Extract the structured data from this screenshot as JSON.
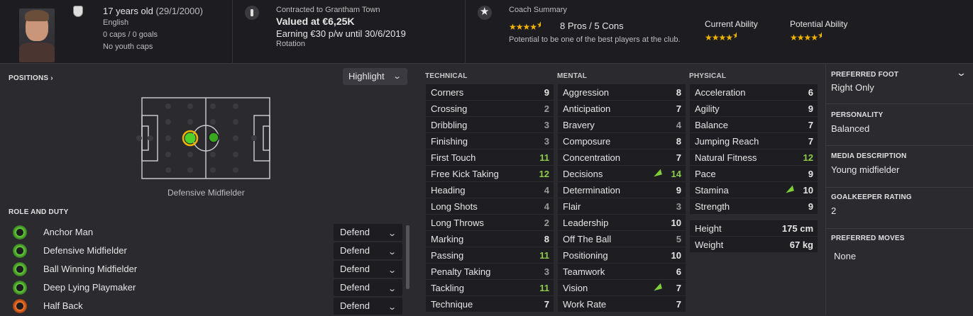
{
  "player": {
    "age_text": "17 years old",
    "dob": "(29/1/2000)",
    "nationality": "English",
    "caps": "0 caps / 0 goals",
    "youth_caps": "No youth caps"
  },
  "contract": {
    "club_line": "Contracted to Grantham Town",
    "value": "Valued at €6,25K",
    "wage": "Earning €30 p/w until 30/6/2019",
    "status": "Rotation"
  },
  "coach": {
    "title": "Coach Summary",
    "pros_cons": "8 Pros / 5 Cons",
    "summary": "Potential to be one of the best players at the club.",
    "rating_stars": 4.5,
    "current_ability_label": "Current Ability",
    "current_ability_stars": 4.5,
    "potential_ability_label": "Potential Ability",
    "potential_ability_stars": 4.5
  },
  "positions": {
    "title": "POSITIONS",
    "highlight_label": "Highlight",
    "position_name": "Defensive Midfielder"
  },
  "role": {
    "title": "ROLE AND DUTY",
    "rows": [
      {
        "name": "Anchor Man",
        "duty": "Defend"
      },
      {
        "name": "Defensive Midfielder",
        "duty": "Defend"
      },
      {
        "name": "Ball Winning Midfielder",
        "duty": "Defend"
      },
      {
        "name": "Deep Lying Playmaker",
        "duty": "Defend"
      },
      {
        "name": "Half Back",
        "duty": "Defend"
      }
    ]
  },
  "technical": {
    "title": "TECHNICAL",
    "rows": [
      {
        "name": "Corners",
        "value": "9"
      },
      {
        "name": "Crossing",
        "value": "2"
      },
      {
        "name": "Dribbling",
        "value": "3"
      },
      {
        "name": "Finishing",
        "value": "3"
      },
      {
        "name": "First Touch",
        "value": "11"
      },
      {
        "name": "Free Kick Taking",
        "value": "12"
      },
      {
        "name": "Heading",
        "value": "4"
      },
      {
        "name": "Long Shots",
        "value": "4"
      },
      {
        "name": "Long Throws",
        "value": "2"
      },
      {
        "name": "Marking",
        "value": "8"
      },
      {
        "name": "Passing",
        "value": "11"
      },
      {
        "name": "Penalty Taking",
        "value": "3"
      },
      {
        "name": "Tackling",
        "value": "11"
      },
      {
        "name": "Technique",
        "value": "7"
      }
    ]
  },
  "mental": {
    "title": "MENTAL",
    "rows": [
      {
        "name": "Aggression",
        "value": "8"
      },
      {
        "name": "Anticipation",
        "value": "7"
      },
      {
        "name": "Bravery",
        "value": "4"
      },
      {
        "name": "Composure",
        "value": "8"
      },
      {
        "name": "Concentration",
        "value": "7"
      },
      {
        "name": "Decisions",
        "value": "14"
      },
      {
        "name": "Determination",
        "value": "9"
      },
      {
        "name": "Flair",
        "value": "3"
      },
      {
        "name": "Leadership",
        "value": "10"
      },
      {
        "name": "Off The Ball",
        "value": "5"
      },
      {
        "name": "Positioning",
        "value": "10"
      },
      {
        "name": "Teamwork",
        "value": "6"
      },
      {
        "name": "Vision",
        "value": "7"
      },
      {
        "name": "Work Rate",
        "value": "7"
      }
    ]
  },
  "physical": {
    "title": "PHYSICAL",
    "rows": [
      {
        "name": "Acceleration",
        "value": "6"
      },
      {
        "name": "Agility",
        "value": "9"
      },
      {
        "name": "Balance",
        "value": "7"
      },
      {
        "name": "Jumping Reach",
        "value": "7"
      },
      {
        "name": "Natural Fitness",
        "value": "12"
      },
      {
        "name": "Pace",
        "value": "9"
      },
      {
        "name": "Stamina",
        "value": "10"
      },
      {
        "name": "Strength",
        "value": "9"
      }
    ],
    "height_label": "Height",
    "height_value": "175 cm",
    "weight_label": "Weight",
    "weight_value": "67 kg"
  },
  "info": {
    "foot_label": "PREFERRED FOOT",
    "foot_value": "Right Only",
    "personality_label": "PERSONALITY",
    "personality_value": "Balanced",
    "media_label": "MEDIA DESCRIPTION",
    "media_value": "Young midfielder",
    "gk_label": "GOALKEEPER RATING",
    "gk_value": "2",
    "moves_label": "PREFERRED MOVES",
    "moves_value": "None"
  },
  "colors": {
    "green": "#8ecb4a",
    "grey": "#9a9a9a",
    "star": "#f0b400",
    "position_dot": "#4fd12a"
  }
}
